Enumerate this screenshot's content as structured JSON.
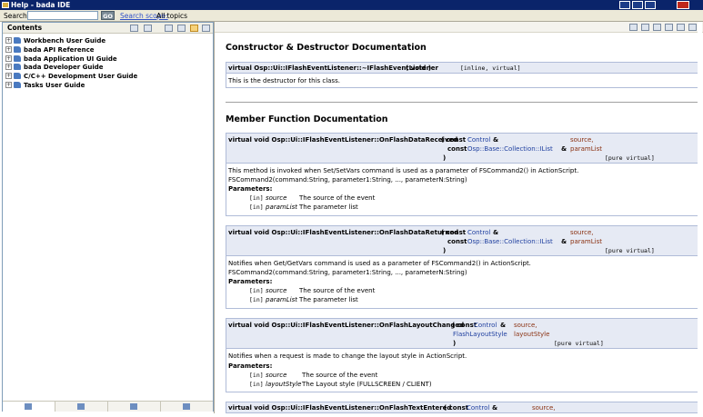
{
  "window": {
    "title": "Help - bada IDE"
  },
  "search": {
    "label": "Search:",
    "value": "",
    "go": "GO",
    "scope_label": "Search scope:",
    "scope_value": "All topics"
  },
  "contents": {
    "title": "Contents",
    "items": [
      {
        "label": "Workbench User Guide"
      },
      {
        "label": "bada API Reference"
      },
      {
        "label": "bada Application UI Guide"
      },
      {
        "label": "bada Developer Guide"
      },
      {
        "label": "C/C++ Development User Guide"
      },
      {
        "label": "Tasks User Guide"
      }
    ]
  },
  "doc": {
    "ctor_heading": "Constructor & Destructor Documentation",
    "dtor": {
      "proto_a": "virtual Osp::Ui::IFlashEventListener::~IFlashEventListener",
      "proto_b": "( void   )",
      "qual": "[inline, virtual]",
      "desc": "This is the destructor for this class."
    },
    "member_heading": "Member Function Documentation",
    "functions": [
      {
        "name": "virtual void Osp::Ui::IFlashEventListener::OnFlashDataReceived",
        "p1_pre": "( const",
        "p1_type": "Control",
        "p1_amp": "&",
        "p1_name": "source,",
        "p2_pre": "const",
        "p2_type": "Osp::Base::Collection::IList",
        "p2_amp": "&",
        "p2_name": "paramList",
        "close": ")",
        "qual": "[pure virtual]",
        "desc1": "This method is invoked when Set/SetVars command is used as a parameter of FSCommand2() in ActionScript.",
        "desc2": "FSCommand2(command:String, parameter1:String, ..., parameterN:String)",
        "params_label": "Parameters:",
        "params": [
          {
            "dir": "[in]",
            "name": "source",
            "desc": "The source of the event"
          },
          {
            "dir": "[in]",
            "name": "paramList",
            "desc": "The parameter list"
          }
        ]
      },
      {
        "name": "virtual void Osp::Ui::IFlashEventListener::OnFlashDataReturned",
        "p1_pre": "( const",
        "p1_type": "Control",
        "p1_amp": "&",
        "p1_name": "source,",
        "p2_pre": "const",
        "p2_type": "Osp::Base::Collection::IList",
        "p2_amp": "&",
        "p2_name": "paramList",
        "close": ")",
        "qual": "[pure virtual]",
        "desc1": "Notifies when Get/GetVars command is used as a parameter of FSCommand2() in ActionScript.",
        "desc2": "FSCommand2(command:String, parameter1:String, ..., parameterN:String)",
        "params_label": "Parameters:",
        "params": [
          {
            "dir": "[in]",
            "name": "source",
            "desc": "The source of the event"
          },
          {
            "dir": "[in]",
            "name": "paramList",
            "desc": "The parameter list"
          }
        ]
      },
      {
        "name": "virtual void Osp::Ui::IFlashEventListener::OnFlashLayoutChanged",
        "p1_pre": "( const",
        "p1_type": "Control",
        "p1_amp": "&",
        "p1_name": "source,",
        "p2_pre": "",
        "p2_type": "FlashLayoutStyle",
        "p2_amp": "",
        "p2_name": "layoutStyle",
        "close": ")",
        "qual": "[pure virtual]",
        "desc1": "Notifies when a request is made to change the layout style in ActionScript.",
        "desc2": "",
        "params_label": "Parameters:",
        "params": [
          {
            "dir": "[in]",
            "name": "source",
            "desc": "The source of the event"
          },
          {
            "dir": "[in]",
            "name": "layoutStyle",
            "desc": "The Layout style (FULLSCREEN / CLIENT)"
          }
        ]
      },
      {
        "name": "virtual void Osp::Ui::IFlashEventListener::OnFlashTextEntered",
        "p1_pre": "( const",
        "p1_type": "Control",
        "p1_amp": "&",
        "p1_name": "source,"
      }
    ]
  }
}
